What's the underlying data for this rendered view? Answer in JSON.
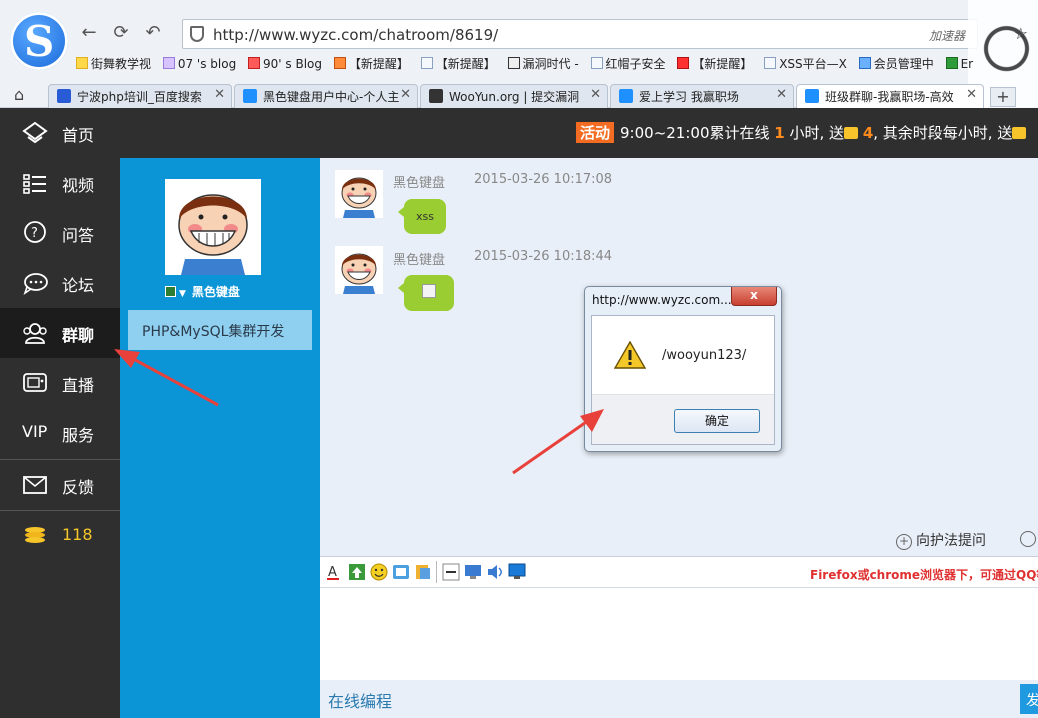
{
  "browser": {
    "url": "http://www.wyzc.com/chatroom/8619/",
    "accelerator": "加速器",
    "bookmarks": [
      "街舞教学视",
      "07 's blog",
      "90' s Blog",
      "【新提醒】",
      "【新提醒】",
      "漏洞时代 -",
      "红帽子安全",
      "【新提醒】",
      "XSS平台—X",
      "会员管理中",
      "Er"
    ],
    "tabs": [
      {
        "title": "宁波php培训_百度搜索",
        "icon_color": "#2a5bd7"
      },
      {
        "title": "黑色键盘用户中心-个人主",
        "icon_color": "#1e90ff"
      },
      {
        "title": "WooYun.org | 提交漏洞",
        "icon_color": "#333333"
      },
      {
        "title": "爱上学习 我赢职场",
        "icon_color": "#1e90ff"
      },
      {
        "title": "班级群聊-我赢职场-高效",
        "icon_color": "#1e90ff"
      }
    ]
  },
  "site": {
    "activity": {
      "badge": "活动",
      "text_before": "9:00~21:00累计在线",
      "hours": "1",
      "text_mid": "小时, 送",
      "count": "4",
      "text_after": ", 其余时段每小时, 送"
    },
    "nav": [
      {
        "label": "首页",
        "icon": "home-icon"
      },
      {
        "label": "视频",
        "icon": "video-list-icon"
      },
      {
        "label": "问答",
        "icon": "question-icon"
      },
      {
        "label": "论坛",
        "icon": "forum-icon"
      },
      {
        "label": "群聊",
        "icon": "group-chat-icon",
        "active": true
      },
      {
        "label": "直播",
        "icon": "live-icon"
      },
      {
        "label": "VIP",
        "label2": "服务",
        "icon": "vip-icon"
      },
      {
        "label": "反馈",
        "icon": "mail-icon"
      },
      {
        "label": "118",
        "icon": "coins-icon"
      }
    ],
    "user": {
      "name": "黑色键盘",
      "group": "PHP&MySQL集群开发"
    }
  },
  "chat": {
    "messages": [
      {
        "user": "黑色键盘",
        "time": "2015-03-26 10:17:08",
        "content": "xss"
      },
      {
        "user": "黑色键盘",
        "time": "2015-03-26 10:18:44",
        "content": ""
      }
    ],
    "guard_link": "向护法提问"
  },
  "input": {
    "notice": "Firefox或chrome浏览器下，可通过QQ等工",
    "online_coding": "在线编程",
    "send_label": "发"
  },
  "alert": {
    "title": "http://www.wyzc.com...",
    "close": "x",
    "message": "/wooyun123/",
    "ok": "确定"
  },
  "colors": {
    "sidebar": "#2f2f2f",
    "user_panel": "#0b95d6",
    "bubble": "#9acd32",
    "accent_orange": "#f36c21",
    "arrow": "#e8403a"
  }
}
